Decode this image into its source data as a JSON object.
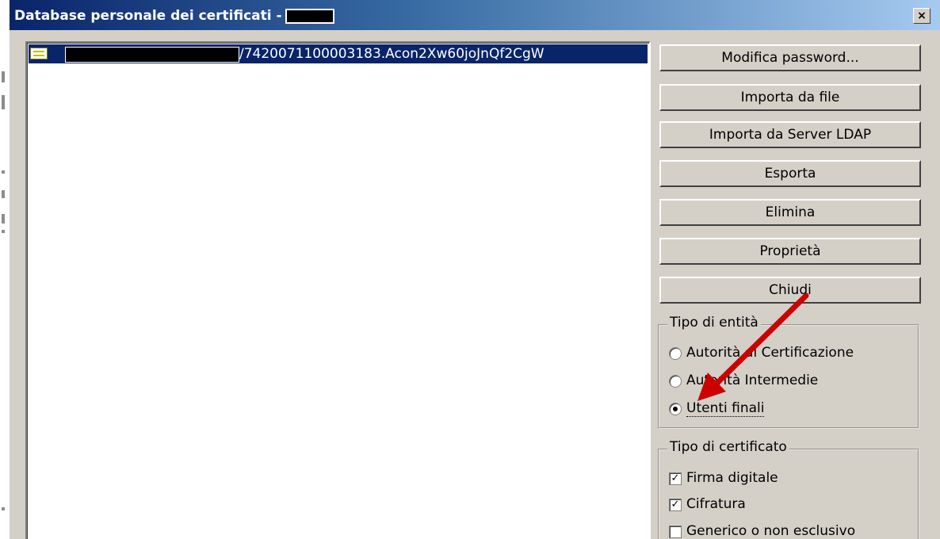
{
  "window": {
    "title": "Database personale dei certificati -",
    "close_glyph": "×"
  },
  "certificate_list": {
    "items": [
      {
        "text": "/7420071100003183.Acon2Xw60joJnQf2CgW",
        "icon": "certificate-icon",
        "selected": true
      }
    ]
  },
  "buttons": {
    "change_password": "Modifica password...",
    "import_file": "Importa da file",
    "import_ldap": "Importa da Server LDAP",
    "export": "Esporta",
    "delete": "Elimina",
    "properties": "Proprietà",
    "close": "Chiudi"
  },
  "entity_type": {
    "legend": "Tipo di entità",
    "options": [
      {
        "label": "Autorità di Certificazione",
        "selected": false
      },
      {
        "label": "Autorità Intermedie",
        "selected": false
      },
      {
        "label": "Utenti finali",
        "selected": true
      }
    ]
  },
  "certificate_type": {
    "legend": "Tipo di certificato",
    "options": [
      {
        "label": "Firma digitale",
        "checked": true
      },
      {
        "label": "Cifratura",
        "checked": true
      },
      {
        "label": "Generico o non esclusivo",
        "checked": false
      }
    ]
  },
  "colors": {
    "title_gradient_start": "#0a246a",
    "title_gradient_end": "#a6caf0",
    "selection": "#0a246a",
    "dialog_face": "#d4d0c8",
    "annotation_arrow": "#cc0000"
  }
}
